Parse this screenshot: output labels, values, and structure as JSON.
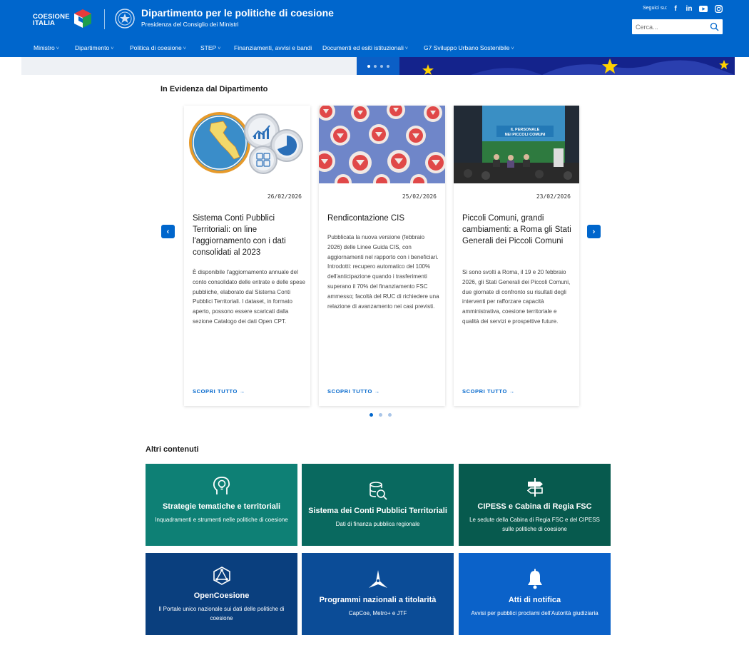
{
  "header": {
    "logo_line1": "COESIONE",
    "logo_line2": "ITALIA",
    "title": "Dipartimento per le politiche di coesione",
    "subtitle": "Presidenza del Consiglio dei Ministri",
    "social_label": "Seguici su:",
    "social": [
      "facebook-icon",
      "linkedin-icon",
      "youtube-icon",
      "instagram-icon"
    ],
    "search_placeholder": "Cerca..."
  },
  "nav": [
    {
      "label": "Ministro",
      "dropdown": true
    },
    {
      "label": "Dipartimento",
      "dropdown": true
    },
    {
      "label": "Politica di coesione",
      "dropdown": true
    },
    {
      "label": "STEP",
      "dropdown": true
    },
    {
      "label": "Finanziamenti, avvisi e bandi",
      "dropdown": false
    },
    {
      "label": "Documenti ed esiti istituzionali",
      "dropdown": true
    },
    {
      "label": "G7 Sviluppo Urbano Sostenibile",
      "dropdown": true
    }
  ],
  "evidenza": {
    "title": "In Evidenza dal Dipartimento",
    "cards": [
      {
        "date": "26/02/2026",
        "title": "Sistema Conti Pubblici Territoriali: on line l'aggiornamento con i dati consolidati al 2023",
        "text": "È disponibile l'aggiornamento annuale del conto consolidato delle entrate e delle spese pubbliche, elaborato dal Sistema Conti Pubblici Territoriali. I dataset, in formato aperto, possono essere scaricati dalla sezione Catalogo dei dati Open CPT.",
        "link": "SCOPRI TUTTO"
      },
      {
        "date": "25/02/2026",
        "title": "Rendicontazione CIS",
        "text": "Pubblicata la nuova versione (febbraio 2026) delle Linee Guida CIS, con aggiornamenti nel rapporto con i beneficiari. Introdotti: recupero automatico del 100% dell'anticipazione quando i trasferimenti superano il 70% del finanziamento FSC ammesso; facoltà del RUC di richiedere una relazione di avanzamento nei casi previsti.",
        "link": "SCOPRI TUTTO"
      },
      {
        "date": "23/02/2026",
        "title": "Piccoli Comuni, grandi cambiamenti: a Roma gli Stati Generali dei Piccoli Comuni",
        "text": "Si sono svolti a Roma, il 19 e 20 febbraio 2026, gli Stati Generali dei Piccoli Comuni, due giornate di confronto su risultati degli interventi per rafforzare capacità amministrativa, coesione territoriale e qualità dei servizi e prospettive future.",
        "link": "SCOPRI TUTTO",
        "image_text": "IL PERSONALE NEI PICCOLI COMUNI"
      }
    ]
  },
  "altri": {
    "title": "Altri contenuti",
    "tiles": [
      {
        "title": "Strategie tematiche e territoriali",
        "desc": "Inquadramenti e strumenti nelle politiche di coesione",
        "icon": "lightbulb-head-icon",
        "color": "#0e8075"
      },
      {
        "title": "Sistema dei Conti Pubblici Territoriali",
        "desc": "Dati di finanza pubblica regionale",
        "icon": "database-search-icon",
        "color": "#09695f"
      },
      {
        "title": "CIPESS e Cabina di Regia FSC",
        "desc": "Le sedute della Cabina di Regia FSC e del CIPESS sulle politiche di coesione",
        "icon": "signpost-icon",
        "color": "#075a4e"
      },
      {
        "title": "OpenCoesione",
        "desc": "Il Portale unico nazionale sui dati delle politiche di coesione",
        "icon": "network-icon",
        "color": "#0a3f7e"
      },
      {
        "title": "Programmi nazionali a titolarità",
        "desc": "CapCoe, Metro+ e JTF",
        "icon": "compass-star-icon",
        "color": "#0b4c97"
      },
      {
        "title": "Atti di notifica",
        "desc": "Avvisi per pubblici proclami dell'Autorità giudiziaria",
        "icon": "bell-icon",
        "color": "#0b62c9"
      }
    ]
  }
}
